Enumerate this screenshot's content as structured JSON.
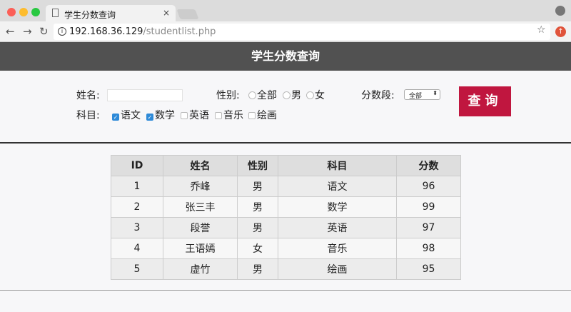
{
  "browser": {
    "tab_title": "学生分数查询",
    "url_host": "192.168.36.129",
    "url_path": "/studentlist.php",
    "close": "×"
  },
  "page": {
    "title": "学生分数查询"
  },
  "form": {
    "name_label": "姓名:",
    "name_value": "",
    "gender_label": "性别:",
    "gender_options": [
      "全部",
      "男",
      "女"
    ],
    "score_label": "分数段:",
    "score_selected": "全部",
    "subject_label": "科目:",
    "subjects": [
      {
        "label": "语文",
        "checked": true
      },
      {
        "label": "数学",
        "checked": true
      },
      {
        "label": "英语",
        "checked": false
      },
      {
        "label": "音乐",
        "checked": false
      },
      {
        "label": "绘画",
        "checked": false
      }
    ],
    "query_button": "查询"
  },
  "table": {
    "headers": [
      "ID",
      "姓名",
      "性别",
      "科目",
      "分数"
    ],
    "rows": [
      [
        "1",
        "乔峰",
        "男",
        "语文",
        "96"
      ],
      [
        "2",
        "张三丰",
        "男",
        "数学",
        "99"
      ],
      [
        "3",
        "段誉",
        "男",
        "英语",
        "97"
      ],
      [
        "4",
        "王语嫣",
        "女",
        "音乐",
        "98"
      ],
      [
        "5",
        "虚竹",
        "男",
        "绘画",
        "95"
      ]
    ]
  }
}
